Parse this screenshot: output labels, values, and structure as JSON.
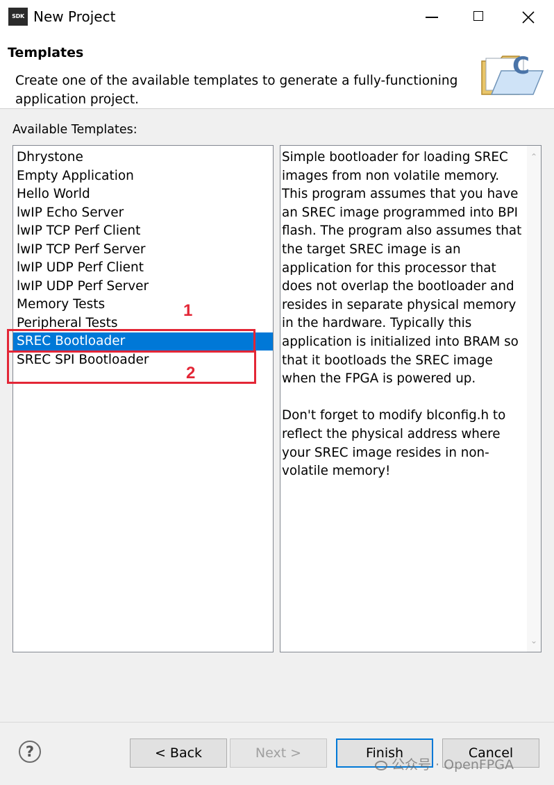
{
  "window": {
    "app_icon_text": "SDK",
    "title": "New Project"
  },
  "banner": {
    "title": "Templates",
    "description": "Create one of the available templates to generate a fully-functioning application project."
  },
  "templates_label": "Available Templates:",
  "templates": [
    {
      "label": "Dhrystone",
      "selected": false
    },
    {
      "label": "Empty Application",
      "selected": false
    },
    {
      "label": "Hello World",
      "selected": false
    },
    {
      "label": "lwIP Echo Server",
      "selected": false
    },
    {
      "label": "lwIP TCP Perf Client",
      "selected": false
    },
    {
      "label": "lwIP TCP Perf Server",
      "selected": false
    },
    {
      "label": "lwIP UDP Perf Client",
      "selected": false
    },
    {
      "label": "lwIP UDP Perf Server",
      "selected": false
    },
    {
      "label": "Memory Tests",
      "selected": false
    },
    {
      "label": "Peripheral Tests",
      "selected": false
    },
    {
      "label": "SREC Bootloader",
      "selected": true
    },
    {
      "label": "SREC SPI Bootloader",
      "selected": false
    }
  ],
  "description_text": "Simple bootloader for loading SREC images from non volatile memory. This program assumes that you have an SREC image programmed into BPI flash. The program also assumes that the target SREC image is an application for this processor that does not overlap the bootloader and resides in separate physical memory in the hardware. Typically this application is initialized into BRAM so that it bootloads the SREC image when the FPGA is powered up.\n\nDon't forget to modify blconfig.h to reflect the physical address where your SREC image resides in non-volatile memory!",
  "annotations": {
    "label_1": "1",
    "label_2": "2",
    "color": "#e32636"
  },
  "buttons": {
    "help": "?",
    "back": "< Back",
    "next": "Next >",
    "finish": "Finish",
    "cancel": "Cancel"
  },
  "watermark": "公众号 · OpenFPGA",
  "colors": {
    "selection": "#0078d7",
    "default_button_border": "#0078d7"
  }
}
